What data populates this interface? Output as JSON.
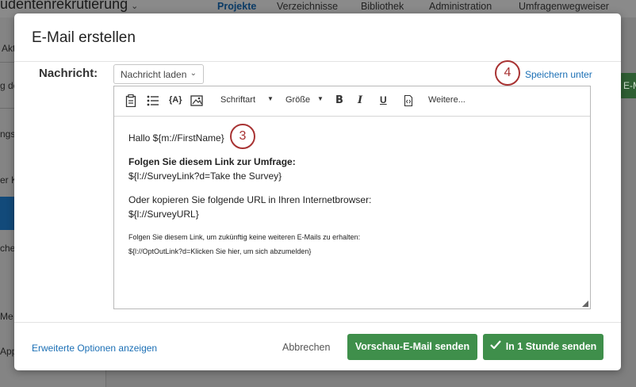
{
  "background": {
    "project_title": "udentenrekrutierung",
    "nav_items": [
      "Projekte",
      "Verzeichnisse",
      "Bibliothek",
      "Administration",
      "Umfragenwegweiser"
    ],
    "sidebar_fragments": [
      "Akt",
      "g de",
      "ngs",
      "er K",
      "che",
      "Me",
      "App"
    ],
    "right_button_fragment": "E-M"
  },
  "modal": {
    "title": "E-Mail erstellen",
    "message_label": "Nachricht:",
    "load_message_select": "Nachricht laden",
    "save_as_link": "Speichern unter",
    "markers": [
      "3",
      "4"
    ],
    "toolbar": {
      "font_label": "Schriftart",
      "size_label": "Größe",
      "bold": "B",
      "italic": "I",
      "underline": "U",
      "more_label": "Weitere..."
    },
    "body": {
      "greeting": "Hallo ${m://FirstName}",
      "link_heading": "Folgen Sie diesem Link zur Umfrage:",
      "survey_link": "${l://SurveyLink?d=Take the Survey}",
      "copy_url_text": "Oder kopieren Sie folgende URL in Ihren Internetbrowser:",
      "survey_url": "${l://SurveyURL}",
      "optout_text": "Folgen Sie diesem Link, um zukünftig keine weiteren E-Mails zu erhalten:",
      "optout_link": "${l://OptOutLink?d=Klicken Sie hier, um sich abzumelden}"
    },
    "footer": {
      "advanced_options_link": "Erweiterte Optionen anzeigen",
      "cancel_label": "Abbrechen",
      "preview_button": "Vorschau-E-Mail senden",
      "send_button": "In 1 Stunde senden"
    }
  },
  "colors": {
    "accent_green": "#3f8f4b",
    "link_blue": "#1b6fb5",
    "marker_red": "#a83333"
  }
}
